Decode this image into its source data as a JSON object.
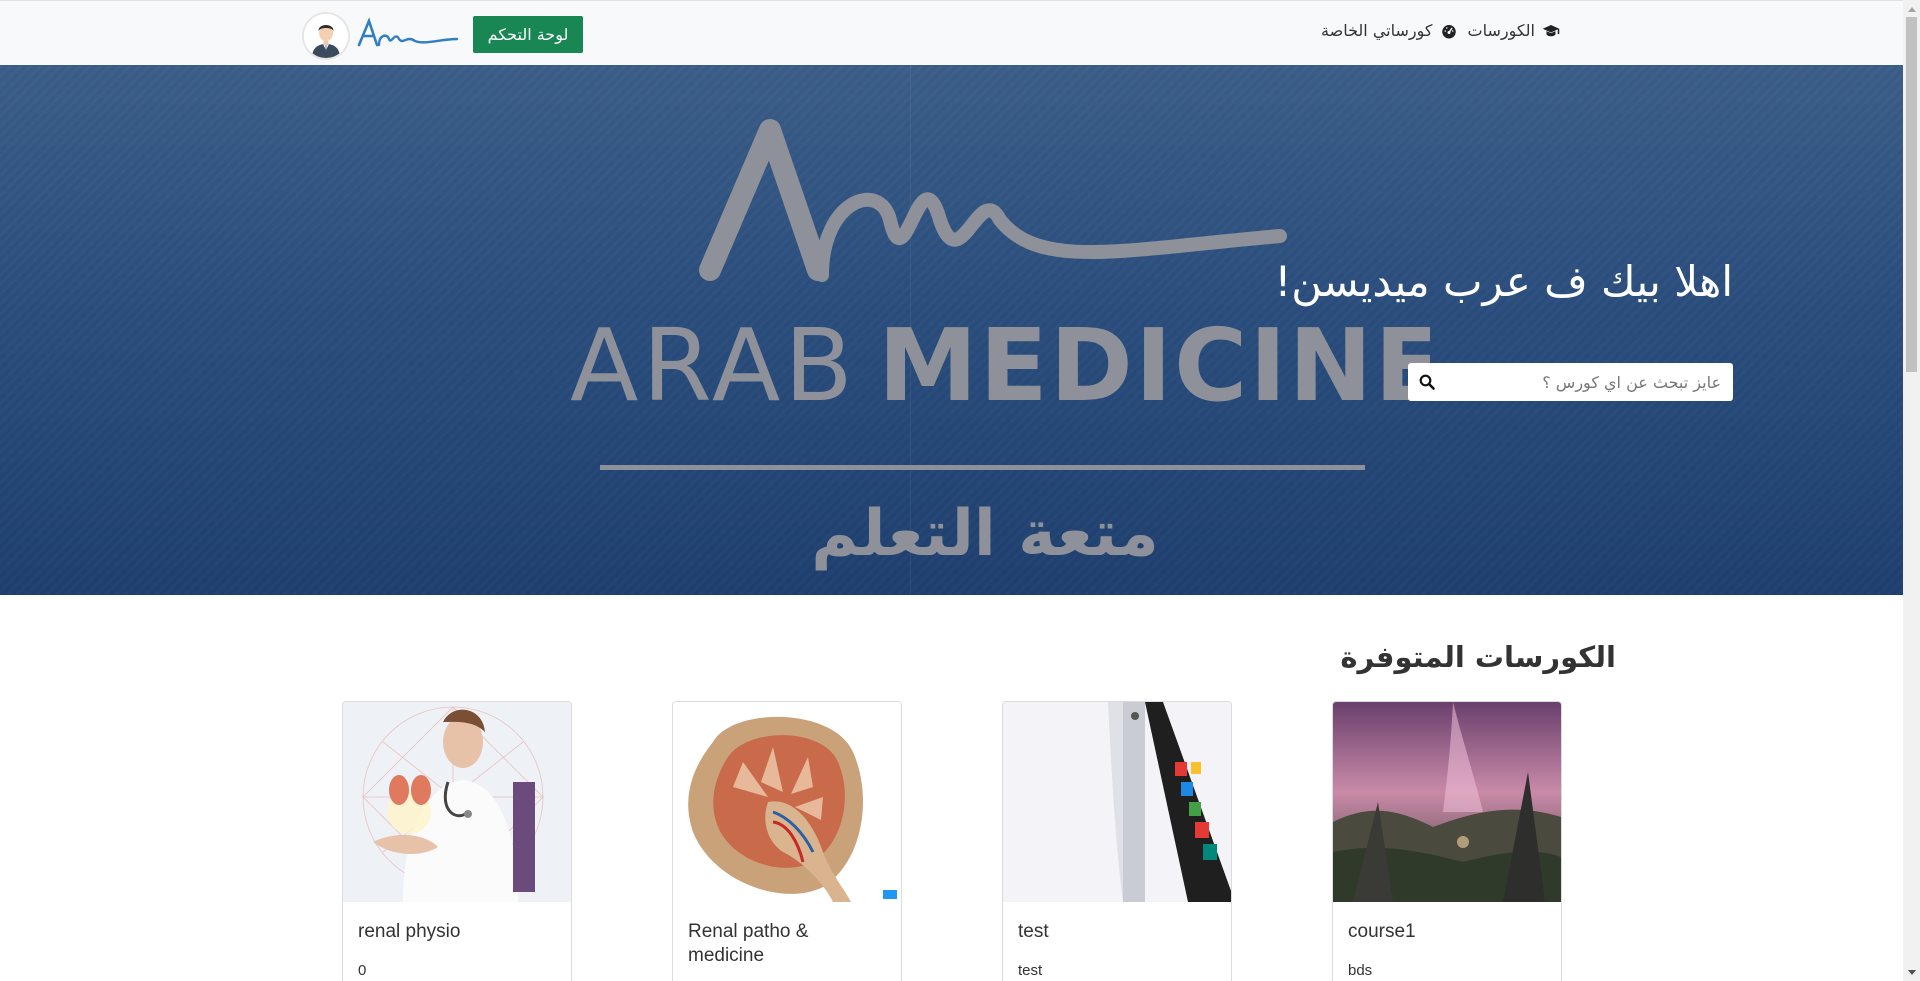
{
  "navbar": {
    "courses_label": "الكورسات",
    "my_courses_label": "كورساتي الخاصة",
    "dashboard_button": "لوحة التحكم",
    "brand_icon": "arab-medicine-logo",
    "avatar_icon": "user-avatar-icon"
  },
  "hero": {
    "title": "اهلا بيك ف عرب ميديسن!",
    "search_placeholder": "عايز تبحث عن اي كورس ؟",
    "search_value": "",
    "logo_text_light": "ARAB",
    "logo_text_bold": "MEDICINE",
    "logo_tagline": "متعة التعلم"
  },
  "courses": {
    "section_title": "الكورسات المتوفرة",
    "items": [
      {
        "title": "renal physio",
        "subtitle": "0"
      },
      {
        "title": "Renal patho & medicine",
        "subtitle": ""
      },
      {
        "title": "test",
        "subtitle": "test"
      },
      {
        "title": "course1",
        "subtitle": "bds"
      }
    ]
  },
  "colors": {
    "accent_green": "#198754",
    "hero_blue": "#2b4e7e",
    "navbar_bg": "#f8f9fa"
  }
}
